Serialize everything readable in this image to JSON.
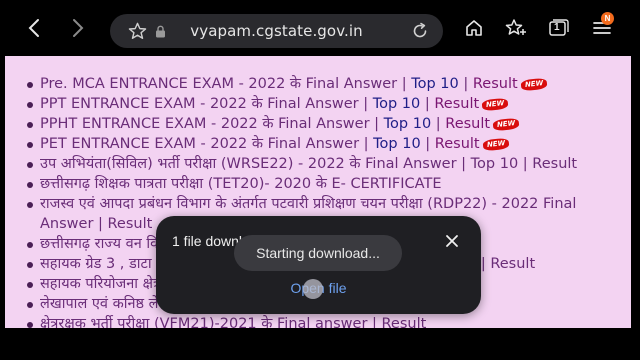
{
  "browser": {
    "url": "vyapam.cgstate.gov.in",
    "tab_count": "1",
    "menu_badge": "N"
  },
  "list_items": [
    {
      "text": "Pre. MCA ENTRANCE EXAM - 2022  के Final Answer | ",
      "top": "Top 10",
      "sep": " | ",
      "result": "Result",
      "new": "NEW"
    },
    {
      "text": "PPT ENTRANCE EXAM - 2022  के Final Answer | ",
      "top": "Top 10",
      "sep": " | ",
      "result": "Result",
      "new": "NEW"
    },
    {
      "text": "PPHT ENTRANCE EXAM - 2022  के Final Answer | ",
      "top": "Top 10",
      "sep": " | ",
      "result": "Result",
      "new": "NEW"
    },
    {
      "text": "PET ENTRANCE EXAM - 2022  के Final Answer | ",
      "top": "Top 10",
      "sep": " | ",
      "result": "Result",
      "new": "NEW"
    },
    {
      "text": "उप अभियंता(सिविल) भर्ती परीक्षा (WRSE22) - 2022 के Final Answer | Top 10 | Result"
    },
    {
      "text": "छत्तीसगढ़ शिक्षक पात्रता परीक्षा (TET20)- 2020 के E- CERTIFICATE"
    },
    {
      "text": "राजस्व एवं आपदा प्रबंधन विभाग के अंतर्गत पटवारी प्रशिक्षण चयन परीक्षा (RDP22) - 2022 Final Answer | Result"
    },
    {
      "text": "छत्तीसगढ़ राज्य वन विभाग"
    },
    {
      "text": "सहायक ग्रेड 3 , डाटा एंट्री                                                                r | Result"
    },
    {
      "text": "सहायक परियोजना क्षेत्र                                                              sult"
    },
    {
      "text": "लेखापाल एवं कनिष्ठ लेखा                                                          sult"
    },
    {
      "text": "क्षेत्ररक्षक भर्ती परीक्षा (VFM21)-2021 के Final answer | Result"
    }
  ],
  "download_dialog": {
    "title": "1 file downloaded",
    "open_label": "Open file",
    "toast": "Starting download..."
  }
}
